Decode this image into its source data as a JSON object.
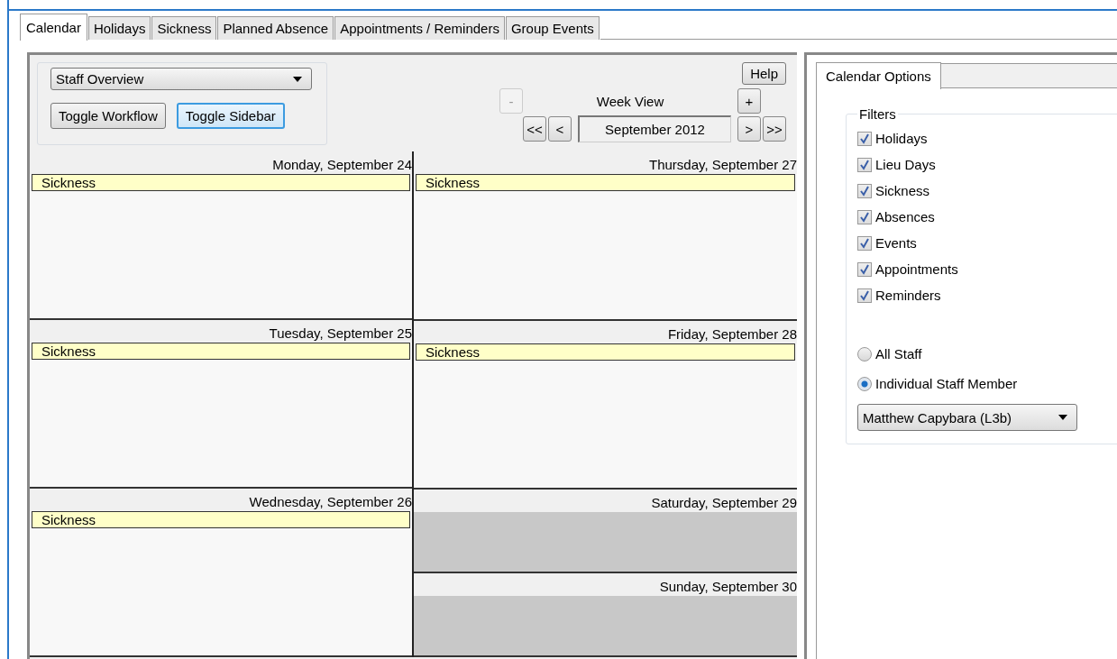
{
  "tabs": [
    {
      "label": "Calendar",
      "selected": true
    },
    {
      "label": "Holidays",
      "selected": false
    },
    {
      "label": "Sickness",
      "selected": false
    },
    {
      "label": "Planned Absence",
      "selected": false
    },
    {
      "label": "Appointments / Reminders",
      "selected": false
    },
    {
      "label": "Group Events",
      "selected": false
    }
  ],
  "view_dropdown": {
    "value": "Staff Overview"
  },
  "toggle_buttons": [
    {
      "label": "Toggle Workflow",
      "focused": false
    },
    {
      "label": "Toggle Sidebar",
      "focused": true
    }
  ],
  "help_button": "Help",
  "navigation": {
    "zoom_out": {
      "label": "-",
      "disabled": true
    },
    "view_label": "Week View",
    "zoom_in": {
      "label": "+",
      "disabled": false
    },
    "first": "<<",
    "previous": "<",
    "period": "September 2012",
    "next": ">",
    "last": ">>"
  },
  "calendar_columns": [
    {
      "days": [
        {
          "header": "Monday, September 24",
          "kind": "weekday",
          "events": [
            "Sickness"
          ]
        },
        {
          "header": "Tuesday, September 25",
          "kind": "weekday",
          "events": [
            "Sickness"
          ]
        },
        {
          "header": "Wednesday, September 26",
          "kind": "weekday",
          "events": [
            "Sickness"
          ]
        }
      ]
    },
    {
      "days": [
        {
          "header": "Thursday, September 27",
          "kind": "weekday",
          "events": [
            "Sickness"
          ]
        },
        {
          "header": "Friday, September 28",
          "kind": "weekday",
          "events": [
            "Sickness"
          ]
        },
        {
          "header": "Saturday, September 29",
          "kind": "weekend"
        },
        {
          "header": "Sunday, September 30",
          "kind": "weekend"
        }
      ]
    }
  ],
  "sidebar": {
    "tab": {
      "label": "Calendar Options"
    },
    "filters_title": "Filters",
    "filters": [
      {
        "label": "Holidays",
        "checked": true
      },
      {
        "label": "Lieu Days",
        "checked": true
      },
      {
        "label": "Sickness",
        "checked": true
      },
      {
        "label": "Absences",
        "checked": true
      },
      {
        "label": "Events",
        "checked": true
      },
      {
        "label": "Appointments",
        "checked": true
      },
      {
        "label": "Reminders",
        "checked": true
      }
    ],
    "staff_scope": [
      {
        "label": "All Staff",
        "selected": false
      },
      {
        "label": "Individual Staff Member",
        "selected": true
      }
    ],
    "staff_dropdown": {
      "value": "Matthew Capybara (L3b)"
    }
  }
}
